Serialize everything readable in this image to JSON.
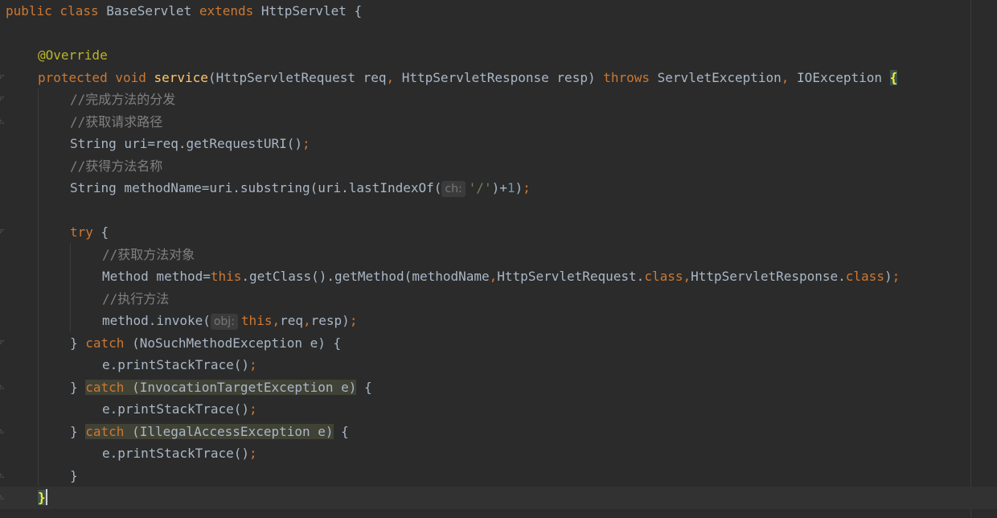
{
  "lines": {
    "l1": {
      "kw1": "public class ",
      "cls": "BaseServlet ",
      "kw2": "extends ",
      "rest": "HttpServlet {"
    },
    "l3": {
      "ann": "@Override"
    },
    "l4": {
      "kw": "protected void ",
      "fn": "service",
      "p1": "(HttpServletRequest req",
      "c1": ", ",
      "p2": "HttpServletResponse resp) ",
      "kw2": "throws ",
      "e1": "ServletException",
      "c2": ", ",
      "e2": "IOException ",
      "brace": "{"
    },
    "l5": {
      "comment": "//完成方法的分发"
    },
    "l6": {
      "comment": "//获取请求路径"
    },
    "l7": {
      "code": "String uri=req.getRequestURI()",
      "semi": ";"
    },
    "l8": {
      "comment": "//获得方法名称"
    },
    "l9": {
      "code": "String methodName=uri.substring(uri.lastIndexOf(",
      "hint": "ch:",
      "str": "'/'",
      "mid": ")+",
      "num": "1",
      "end": ")",
      "semi": ";"
    },
    "l11": {
      "kw": "try ",
      "brace": "{"
    },
    "l12": {
      "comment": "//获取方法对象"
    },
    "l13": {
      "a": "Method method=",
      "this": "this",
      "b": ".getClass().getMethod(methodName",
      "c1": ",",
      "c": "HttpServletRequest.",
      "cls1": "class",
      "c2": ",",
      "d": "HttpServletResponse.",
      "cls2": "class",
      "e": ")",
      "semi": ";"
    },
    "l14": {
      "comment": "//执行方法"
    },
    "l15": {
      "a": "method.invoke(",
      "hint": "obj:",
      "this": "this",
      "c1": ",",
      "b": "req",
      "c2": ",",
      "c": "resp)",
      "semi": ";"
    },
    "l16": {
      "a": "} ",
      "kw": "catch ",
      "b": "(NoSuchMethodException e) {"
    },
    "l17": {
      "code": "e.printStackTrace()",
      "semi": ";"
    },
    "l18": {
      "a": "} ",
      "kw": "catch",
      "b": " (InvocationTargetException e)",
      "c": " {"
    },
    "l19": {
      "code": "e.printStackTrace()",
      "semi": ";"
    },
    "l20": {
      "a": "} ",
      "kw": "catch",
      "b": " (IllegalAccessException e)",
      "c": " {"
    },
    "l21": {
      "code": "e.printStackTrace()",
      "semi": ";"
    },
    "l22": {
      "code": "}"
    },
    "l23": {
      "code": "}"
    }
  },
  "colors": {
    "background": "#2b2b2b",
    "keyword": "#cc7832",
    "function": "#ffc66d",
    "annotation": "#bbb529",
    "comment": "#808080",
    "string": "#6a8759",
    "number": "#6897bb",
    "text": "#a9b7c6"
  }
}
